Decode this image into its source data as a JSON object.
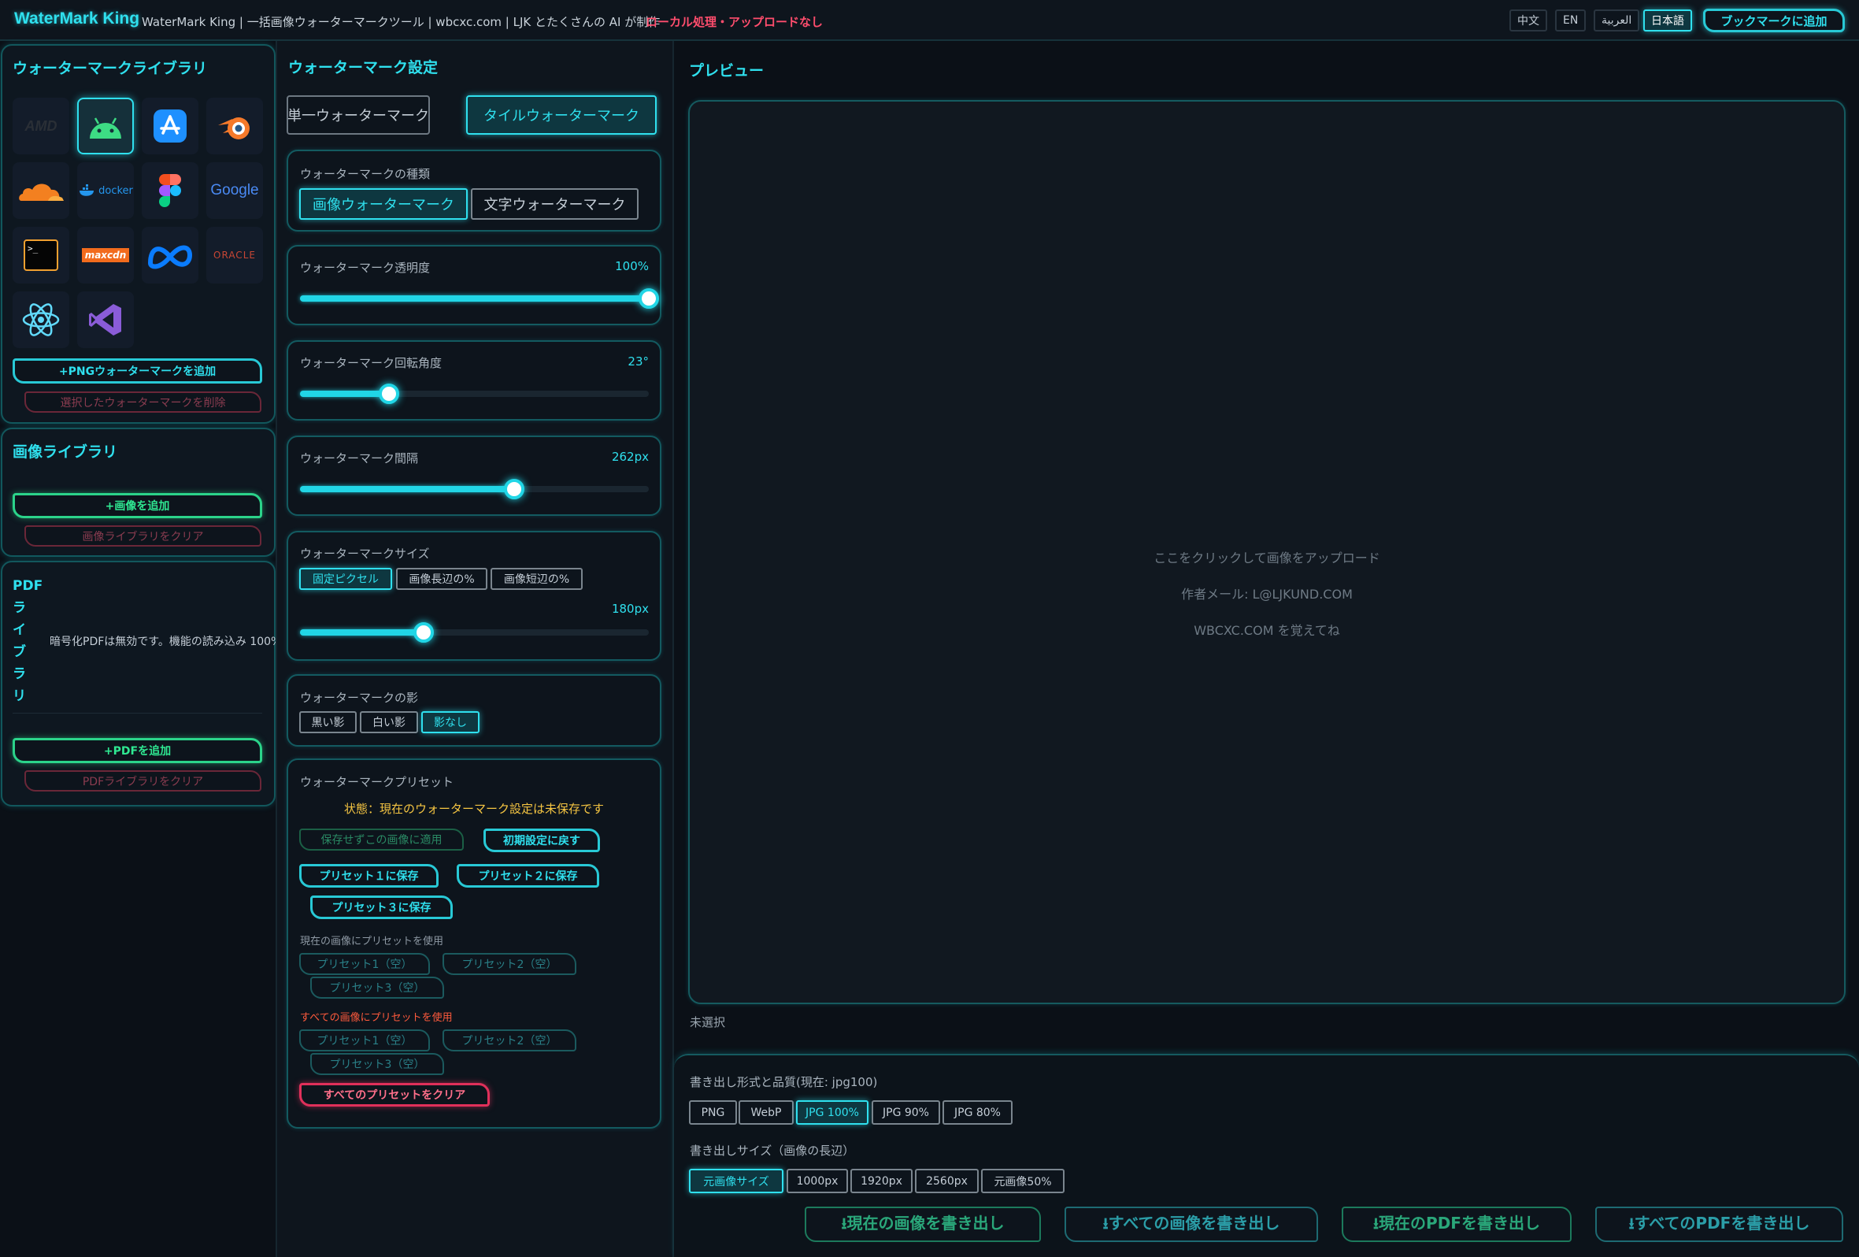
{
  "header": {
    "brand": "WaterMark King",
    "subtitle": "WaterMark King | 一括画像ウォーターマークツール | wbcxc.com | LJK とたくさんの AI が制作",
    "local_note": "ローカル処理・アップロードなし",
    "languages": [
      "中文",
      "EN",
      "العربية",
      "日本語"
    ],
    "bookmark": "ブックマークに追加"
  },
  "wm_library": {
    "title": "ウォーターマークライブラリ",
    "icons": [
      "amd-logo-icon",
      "android-icon",
      "app-store-icon",
      "blender-icon",
      "cloudflare-icon",
      "docker-icon",
      "figma-icon",
      "google-icon",
      "terminal-icon",
      "maxcdn-icon",
      "meta-icon",
      "oracle-icon",
      "react-icon",
      "visual-studio-icon"
    ],
    "icon_texts": {
      "amd": "AMD",
      "docker": "docker",
      "google": "Google",
      "maxcdn": "maxcdn",
      "oracle": "ORACLE",
      "terminal": ">_"
    },
    "add_png": "+PNGウォーターマークを追加",
    "delete_selected": "選択したウォーターマークを削除"
  },
  "image_library": {
    "title": "画像ライブラリ",
    "add": "+画像を追加",
    "clear": "画像ライブラリをクリア"
  },
  "pdf_library": {
    "title": "PDF",
    "title_vertical": [
      "ラ",
      "イ",
      "ブ",
      "ラ",
      "リ"
    ],
    "status": "暗号化PDFは無効です。機能の読み込み 100%",
    "add": "+PDFを追加",
    "clear": "PDFライブラリをクリア"
  },
  "settings": {
    "title": "ウォーターマーク設定",
    "mode_single": "単一ウォーターマーク",
    "mode_tile": "タイルウォーターマーク",
    "type_label": "ウォーターマークの種類",
    "type_image": "画像ウォーターマーク",
    "type_text": "文字ウォーターマーク",
    "opacity_label": "ウォーターマーク透明度",
    "opacity_value": "100%",
    "opacity_level": 1.0,
    "rotation_label": "ウォーターマーク回転角度",
    "rotation_value": "23°",
    "rotation_level": 0.255,
    "spacing_label": "ウォーターマーク間隔",
    "spacing_value": "262px",
    "spacing_level": 0.615,
    "size_label": "ウォーターマークサイズ",
    "size_fixed": "固定ピクセル",
    "size_long": "画像長辺の%",
    "size_short": "画像短辺の%",
    "size_value": "180px",
    "size_level": 0.355,
    "shadow_label": "ウォーターマークの影",
    "shadow_black": "黒い影",
    "shadow_white": "白い影",
    "shadow_none": "影なし",
    "preset_label": "ウォーターマークプリセット",
    "preset_status": "状態：現在のウォーターマーク設定は未保存です",
    "apply_unsaved": "保存せずこの画像に適用",
    "reset": "初期設定に戻す",
    "save1": "プリセット１に保存",
    "save2": "プリセット２に保存",
    "save3": "プリセット３に保存",
    "current_label": "現在の画像にプリセットを使用",
    "preset1_empty": "プリセット1（空）",
    "preset2_empty": "プリセット2（空）",
    "preset3_empty": "プリセット3（空）",
    "all_label": "すべての画像にプリセットを使用",
    "clear_all": "すべてのプリセットをクリア"
  },
  "preview": {
    "title": "プレビュー",
    "upload_hint": "ここをクリックして画像をアップロード",
    "email": "作者メール: L@LJKUND.COM",
    "remember": "WBCXC.COM を覚えてね",
    "selection": "未選択"
  },
  "export": {
    "format_label": "書き出し形式と品質(現在: jpg100)",
    "formats": [
      "PNG",
      "WebP",
      "JPG 100%",
      "JPG 90%",
      "JPG 80%"
    ],
    "size_label": "書き出しサイズ（画像の長辺）",
    "sizes": [
      "元画像サイズ",
      "1000px",
      "1920px",
      "2560px",
      "元画像50%"
    ],
    "export_current_image": "⭳現在の画像を書き出し",
    "export_all_images": "⭳すべての画像を書き出し",
    "export_current_pdf": "⭳現在のPDFを書き出し",
    "export_all_pdf": "⭳すべてのPDFを書き出し"
  },
  "colors": {
    "accent": "#2fe0ee",
    "green": "#2fe892",
    "red": "#ff4d6d",
    "warn": "#f5c542",
    "bg": "#0b1017"
  }
}
